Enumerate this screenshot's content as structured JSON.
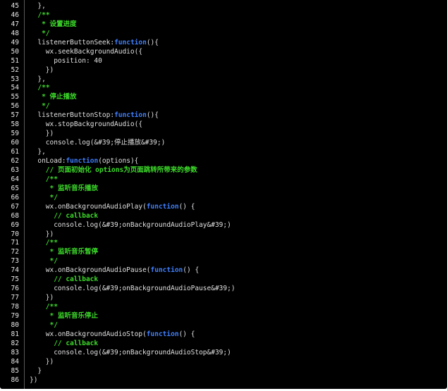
{
  "editor": {
    "first_line": 45,
    "colors": {
      "background": "#000000",
      "text": "#e0e0e0",
      "keyword": "#3f7fff",
      "comment": "#3ddc2a",
      "line_number": "#e8e8e8"
    },
    "lines": [
      {
        "n": "45",
        "indent": 2,
        "tokens": [
          {
            "t": "},",
            "s": "p"
          }
        ]
      },
      {
        "n": "46",
        "indent": 2,
        "tokens": [
          {
            "t": "/**",
            "s": "c"
          }
        ]
      },
      {
        "n": "47",
        "indent": 3,
        "tokens": [
          {
            "t": "* 设置进度",
            "s": "c"
          }
        ]
      },
      {
        "n": "48",
        "indent": 3,
        "tokens": [
          {
            "t": "*/",
            "s": "c"
          }
        ]
      },
      {
        "n": "49",
        "indent": 2,
        "tokens": [
          {
            "t": "listenerButtonSeek:",
            "s": "p"
          },
          {
            "t": "function",
            "s": "k"
          },
          {
            "t": "(){",
            "s": "p"
          }
        ]
      },
      {
        "n": "50",
        "indent": 4,
        "tokens": [
          {
            "t": "wx.seekBackgroundAudio({",
            "s": "p"
          }
        ]
      },
      {
        "n": "51",
        "indent": 6,
        "tokens": [
          {
            "t": "position: 40",
            "s": "p"
          }
        ]
      },
      {
        "n": "52",
        "indent": 4,
        "tokens": [
          {
            "t": "})",
            "s": "p"
          }
        ]
      },
      {
        "n": "53",
        "indent": 2,
        "tokens": [
          {
            "t": "},",
            "s": "p"
          }
        ]
      },
      {
        "n": "54",
        "indent": 2,
        "tokens": [
          {
            "t": "/**",
            "s": "c"
          }
        ]
      },
      {
        "n": "55",
        "indent": 3,
        "tokens": [
          {
            "t": "* 停止播放",
            "s": "c"
          }
        ]
      },
      {
        "n": "56",
        "indent": 3,
        "tokens": [
          {
            "t": "*/",
            "s": "c"
          }
        ]
      },
      {
        "n": "57",
        "indent": 2,
        "tokens": [
          {
            "t": "listenerButtonStop:",
            "s": "p"
          },
          {
            "t": "function",
            "s": "k"
          },
          {
            "t": "(){",
            "s": "p"
          }
        ]
      },
      {
        "n": "58",
        "indent": 4,
        "tokens": [
          {
            "t": "wx.stopBackgroundAudio({",
            "s": "p"
          }
        ]
      },
      {
        "n": "59",
        "indent": 4,
        "tokens": [
          {
            "t": "})",
            "s": "p"
          }
        ]
      },
      {
        "n": "60",
        "indent": 4,
        "tokens": [
          {
            "t": "console.log(&#39;停止播放&#39;)",
            "s": "p"
          }
        ]
      },
      {
        "n": "61",
        "indent": 2,
        "tokens": [
          {
            "t": "},",
            "s": "p"
          }
        ]
      },
      {
        "n": "62",
        "indent": 2,
        "tokens": [
          {
            "t": "onLoad:",
            "s": "p"
          },
          {
            "t": "function",
            "s": "k"
          },
          {
            "t": "(options){",
            "s": "p"
          }
        ]
      },
      {
        "n": "63",
        "indent": 4,
        "tokens": [
          {
            "t": "// 页面初始化 options为页面跳转所带来的参数",
            "s": "c"
          }
        ]
      },
      {
        "n": "64",
        "indent": 4,
        "tokens": [
          {
            "t": "/**",
            "s": "c"
          }
        ]
      },
      {
        "n": "65",
        "indent": 5,
        "tokens": [
          {
            "t": "* 监听音乐播放",
            "s": "c"
          }
        ]
      },
      {
        "n": "66",
        "indent": 5,
        "tokens": [
          {
            "t": "*/",
            "s": "c"
          }
        ]
      },
      {
        "n": "67",
        "indent": 4,
        "tokens": [
          {
            "t": "wx.onBackgroundAudioPlay(",
            "s": "p"
          },
          {
            "t": "function",
            "s": "k"
          },
          {
            "t": "() {",
            "s": "p"
          }
        ]
      },
      {
        "n": "68",
        "indent": 6,
        "tokens": [
          {
            "t": "// callback",
            "s": "c"
          }
        ]
      },
      {
        "n": "69",
        "indent": 6,
        "tokens": [
          {
            "t": "console.log(&#39;onBackgroundAudioPlay&#39;)",
            "s": "p"
          }
        ]
      },
      {
        "n": "70",
        "indent": 4,
        "tokens": [
          {
            "t": "})",
            "s": "p"
          }
        ]
      },
      {
        "n": "71",
        "indent": 4,
        "tokens": [
          {
            "t": "/**",
            "s": "c"
          }
        ]
      },
      {
        "n": "72",
        "indent": 5,
        "tokens": [
          {
            "t": "* 监听音乐暂停",
            "s": "c"
          }
        ]
      },
      {
        "n": "73",
        "indent": 5,
        "tokens": [
          {
            "t": "*/",
            "s": "c"
          }
        ]
      },
      {
        "n": "74",
        "indent": 4,
        "tokens": [
          {
            "t": "wx.onBackgroundAudioPause(",
            "s": "p"
          },
          {
            "t": "function",
            "s": "k"
          },
          {
            "t": "() {",
            "s": "p"
          }
        ]
      },
      {
        "n": "75",
        "indent": 6,
        "tokens": [
          {
            "t": "// callback",
            "s": "c"
          }
        ]
      },
      {
        "n": "76",
        "indent": 6,
        "tokens": [
          {
            "t": "console.log(&#39;onBackgroundAudioPause&#39;)",
            "s": "p"
          }
        ]
      },
      {
        "n": "77",
        "indent": 4,
        "tokens": [
          {
            "t": "})",
            "s": "p"
          }
        ]
      },
      {
        "n": "78",
        "indent": 4,
        "tokens": [
          {
            "t": "/**",
            "s": "c"
          }
        ]
      },
      {
        "n": "79",
        "indent": 5,
        "tokens": [
          {
            "t": "* 监听音乐停止",
            "s": "c"
          }
        ]
      },
      {
        "n": "80",
        "indent": 5,
        "tokens": [
          {
            "t": "*/",
            "s": "c"
          }
        ]
      },
      {
        "n": "81",
        "indent": 4,
        "tokens": [
          {
            "t": "wx.onBackgroundAudioStop(",
            "s": "p"
          },
          {
            "t": "function",
            "s": "k"
          },
          {
            "t": "() {",
            "s": "p"
          }
        ]
      },
      {
        "n": "82",
        "indent": 6,
        "tokens": [
          {
            "t": "// callback",
            "s": "c"
          }
        ]
      },
      {
        "n": "83",
        "indent": 6,
        "tokens": [
          {
            "t": "console.log(&#39;onBackgroundAudioStop&#39;)",
            "s": "p"
          }
        ]
      },
      {
        "n": "84",
        "indent": 4,
        "tokens": [
          {
            "t": "})",
            "s": "p"
          }
        ]
      },
      {
        "n": "85",
        "indent": 2,
        "tokens": [
          {
            "t": "}",
            "s": "p"
          }
        ]
      },
      {
        "n": "86",
        "indent": 0,
        "tokens": [
          {
            "t": "})",
            "s": "p"
          }
        ]
      }
    ]
  }
}
